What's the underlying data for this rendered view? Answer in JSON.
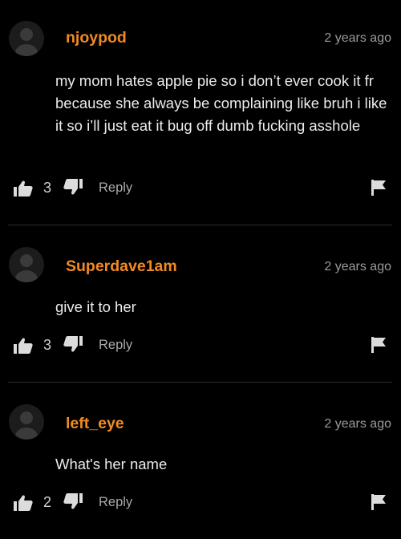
{
  "colors": {
    "background": "#000000",
    "username": "#f08a24",
    "text": "#ececec",
    "muted": "#9a9a9a"
  },
  "comments": [
    {
      "username": "njoypod",
      "time": "2 years ago",
      "text": "my mom hates apple pie so i don’t ever cook it fr because she always be complaining like bruh i like it so i’ll just eat it bug off dumb fucking asshole",
      "likes": "3",
      "reply_label": "Reply",
      "icons": {
        "avatar": "user-avatar-icon",
        "like": "thumbs-up-icon",
        "dislike": "thumbs-down-icon",
        "flag": "flag-icon"
      }
    },
    {
      "username": "Superdave1am",
      "time": "2 years ago",
      "text": "give it to her",
      "likes": "3",
      "reply_label": "Reply",
      "icons": {
        "avatar": "user-avatar-icon",
        "like": "thumbs-up-icon",
        "dislike": "thumbs-down-icon",
        "flag": "flag-icon"
      }
    },
    {
      "username": "left_eye",
      "time": "2 years ago",
      "text": "What's her name",
      "likes": "2",
      "reply_label": "Reply",
      "icons": {
        "avatar": "user-avatar-icon",
        "like": "thumbs-up-icon",
        "dislike": "thumbs-down-icon",
        "flag": "flag-icon"
      }
    }
  ]
}
